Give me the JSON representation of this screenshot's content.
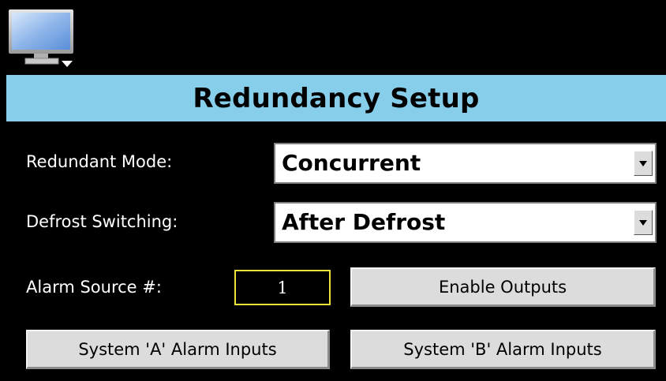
{
  "header": {
    "icon": "monitor-icon",
    "title": "Redundancy Setup",
    "title_bar_color": "#87ceea"
  },
  "redundant_mode": {
    "label": "Redundant Mode:",
    "value": "Concurrent"
  },
  "defrost_switching": {
    "label": "Defrost Switching:",
    "value": "After Defrost"
  },
  "alarm_source": {
    "label": "Alarm Source #:",
    "value": "1",
    "border_color": "#e8e23a"
  },
  "buttons": {
    "enable_outputs": "Enable Outputs",
    "system_a_alarm_inputs": "System 'A' Alarm Inputs",
    "system_b_alarm_inputs": "System 'B' Alarm Inputs"
  }
}
